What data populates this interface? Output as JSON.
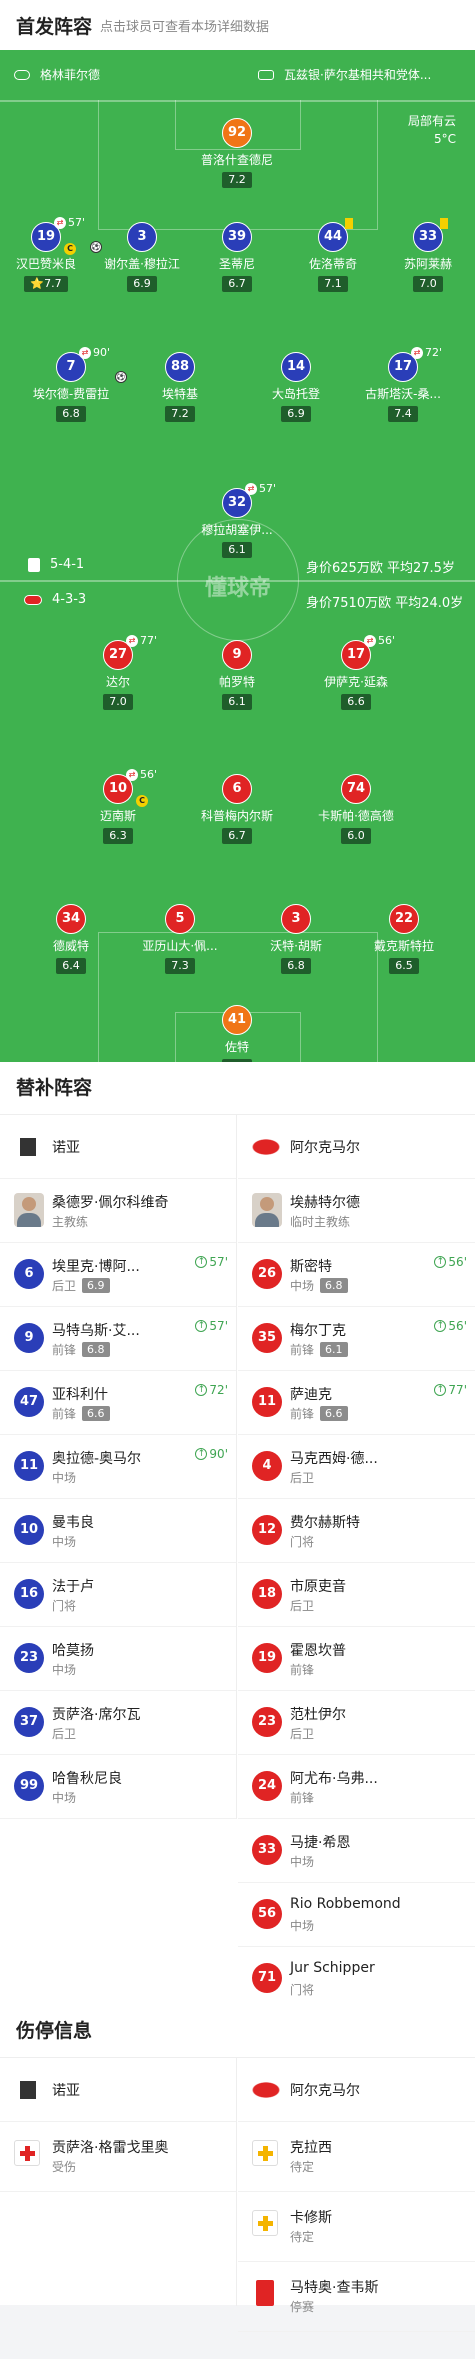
{
  "header": {
    "title": "首发阵容",
    "subtitle": "点击球员可查看本场详细数据"
  },
  "pitch": {
    "home_team": "格林菲尔德",
    "away_team": "瓦兹银·萨尔基相共和党体...",
    "weather_line1": "局部有云",
    "weather_line2": "5°C",
    "watermark": "懂球帝",
    "home_form": "5-4-1",
    "home_stats": "身价625万欧  平均27.5岁",
    "away_form": "4-3-3",
    "away_stats": "身价7510万欧  平均24.0岁"
  },
  "home_players": [
    {
      "num": "92",
      "name": "普洛什查德尼",
      "rating": "7.2",
      "color": "orange"
    },
    {
      "num": "19",
      "name": "汉巴赞米良",
      "rating": "7.7",
      "color": "blue",
      "sub": "57'"
    },
    {
      "num": "3",
      "name": "谢尔盖·穆拉江",
      "rating": "6.9",
      "color": "blue"
    },
    {
      "num": "39",
      "name": "圣蒂尼",
      "rating": "6.7",
      "color": "blue"
    },
    {
      "num": "44",
      "name": "佐洛蒂奇",
      "rating": "7.1",
      "color": "blue"
    },
    {
      "num": "33",
      "name": "苏阿莱赫",
      "rating": "7.0",
      "color": "blue"
    },
    {
      "num": "7",
      "name": "埃尔德-费雷拉",
      "rating": "6.8",
      "color": "blue",
      "sub": "90'"
    },
    {
      "num": "88",
      "name": "埃特基",
      "rating": "7.2",
      "color": "blue"
    },
    {
      "num": "14",
      "name": "大岛托登",
      "rating": "6.9",
      "color": "blue"
    },
    {
      "num": "17",
      "name": "古斯塔沃-桑...",
      "rating": "7.4",
      "color": "blue",
      "sub": "72'"
    },
    {
      "num": "32",
      "name": "穆拉胡塞伊...",
      "rating": "6.1",
      "color": "blue",
      "sub": "57'"
    }
  ],
  "away_players": [
    {
      "num": "27",
      "name": "达尔",
      "rating": "7.0",
      "color": "red",
      "sub": "77'"
    },
    {
      "num": "9",
      "name": "帕罗特",
      "rating": "6.1",
      "color": "red"
    },
    {
      "num": "17",
      "name": "伊萨克·延森",
      "rating": "6.6",
      "color": "red",
      "sub": "56'"
    },
    {
      "num": "10",
      "name": "迈南斯",
      "rating": "6.3",
      "color": "red",
      "sub": "56'"
    },
    {
      "num": "6",
      "name": "科普梅内尔斯",
      "rating": "6.7",
      "color": "red"
    },
    {
      "num": "74",
      "name": "卡斯帕·德高德",
      "rating": "6.0",
      "color": "red"
    },
    {
      "num": "34",
      "name": "德威特",
      "rating": "6.4",
      "color": "red"
    },
    {
      "num": "5",
      "name": "亚历山大·佩...",
      "rating": "7.3",
      "color": "red"
    },
    {
      "num": "3",
      "name": "沃特·胡斯",
      "rating": "6.8",
      "color": "red"
    },
    {
      "num": "22",
      "name": "戴克斯特拉",
      "rating": "6.5",
      "color": "red"
    },
    {
      "num": "41",
      "name": "佐特",
      "rating": "6.9",
      "color": "orange"
    }
  ],
  "subs": {
    "title": "替补阵容",
    "home_team": "诺亚",
    "away_team": "阿尔克马尔",
    "home_coach": {
      "name": "桑德罗·佩尔科维奇",
      "role": "主教练"
    },
    "away_coach": {
      "name": "埃赫特尔德",
      "role": "临时主教练"
    },
    "home": [
      {
        "num": "6",
        "name": "埃里克·博阿...",
        "pos": "后卫",
        "rating": "6.9",
        "time": "57'"
      },
      {
        "num": "9",
        "name": "马特乌斯·艾...",
        "pos": "前锋",
        "rating": "6.8",
        "time": "57'"
      },
      {
        "num": "47",
        "name": "亚科利什",
        "pos": "前锋",
        "rating": "6.6",
        "time": "72'"
      },
      {
        "num": "11",
        "name": "奥拉德-奥马尔",
        "pos": "中场",
        "rating": "",
        "time": "90'"
      },
      {
        "num": "10",
        "name": "曼韦良",
        "pos": "中场",
        "rating": "",
        "time": ""
      },
      {
        "num": "16",
        "name": "法于卢",
        "pos": "门将",
        "rating": "",
        "time": ""
      },
      {
        "num": "23",
        "name": "哈莫扬",
        "pos": "中场",
        "rating": "",
        "time": ""
      },
      {
        "num": "37",
        "name": "贡萨洛·席尔瓦",
        "pos": "后卫",
        "rating": "",
        "time": ""
      },
      {
        "num": "99",
        "name": "哈鲁秋尼良",
        "pos": "中场",
        "rating": "",
        "time": ""
      }
    ],
    "away": [
      {
        "num": "26",
        "name": "斯密特",
        "pos": "中场",
        "rating": "6.8",
        "time": "56'"
      },
      {
        "num": "35",
        "name": "梅尔丁克",
        "pos": "前锋",
        "rating": "6.1",
        "time": "56'"
      },
      {
        "num": "11",
        "name": "萨迪克",
        "pos": "前锋",
        "rating": "6.6",
        "time": "77'"
      },
      {
        "num": "4",
        "name": "马克西姆·德...",
        "pos": "后卫",
        "rating": "",
        "time": ""
      },
      {
        "num": "12",
        "name": "费尔赫斯特",
        "pos": "门将",
        "rating": "",
        "time": ""
      },
      {
        "num": "18",
        "name": "市原吏音",
        "pos": "后卫",
        "rating": "",
        "time": ""
      },
      {
        "num": "19",
        "name": "霍恩坎普",
        "pos": "前锋",
        "rating": "",
        "time": ""
      },
      {
        "num": "23",
        "name": "范杜伊尔",
        "pos": "后卫",
        "rating": "",
        "time": ""
      },
      {
        "num": "24",
        "name": "阿尤布·乌弗...",
        "pos": "前锋",
        "rating": "",
        "time": ""
      },
      {
        "num": "33",
        "name": "马捷·希恩",
        "pos": "中场",
        "rating": "",
        "time": ""
      },
      {
        "num": "56",
        "name": "Rio Robbemond",
        "pos": "中场",
        "rating": "",
        "time": ""
      },
      {
        "num": "71",
        "name": "Jur Schipper",
        "pos": "门将",
        "rating": "",
        "time": ""
      }
    ]
  },
  "injuries": {
    "title": "伤停信息",
    "home_team": "诺亚",
    "away_team": "阿尔克马尔",
    "home": [
      {
        "name": "贡萨洛·格雷戈里奥",
        "status": "受伤",
        "kind": "injury"
      }
    ],
    "away": [
      {
        "name": "克拉西",
        "status": "待定",
        "kind": "doubt"
      },
      {
        "name": "卡修斯",
        "status": "待定",
        "kind": "doubt"
      },
      {
        "name": "马特奥·查韦斯",
        "status": "停赛",
        "kind": "red"
      }
    ]
  }
}
